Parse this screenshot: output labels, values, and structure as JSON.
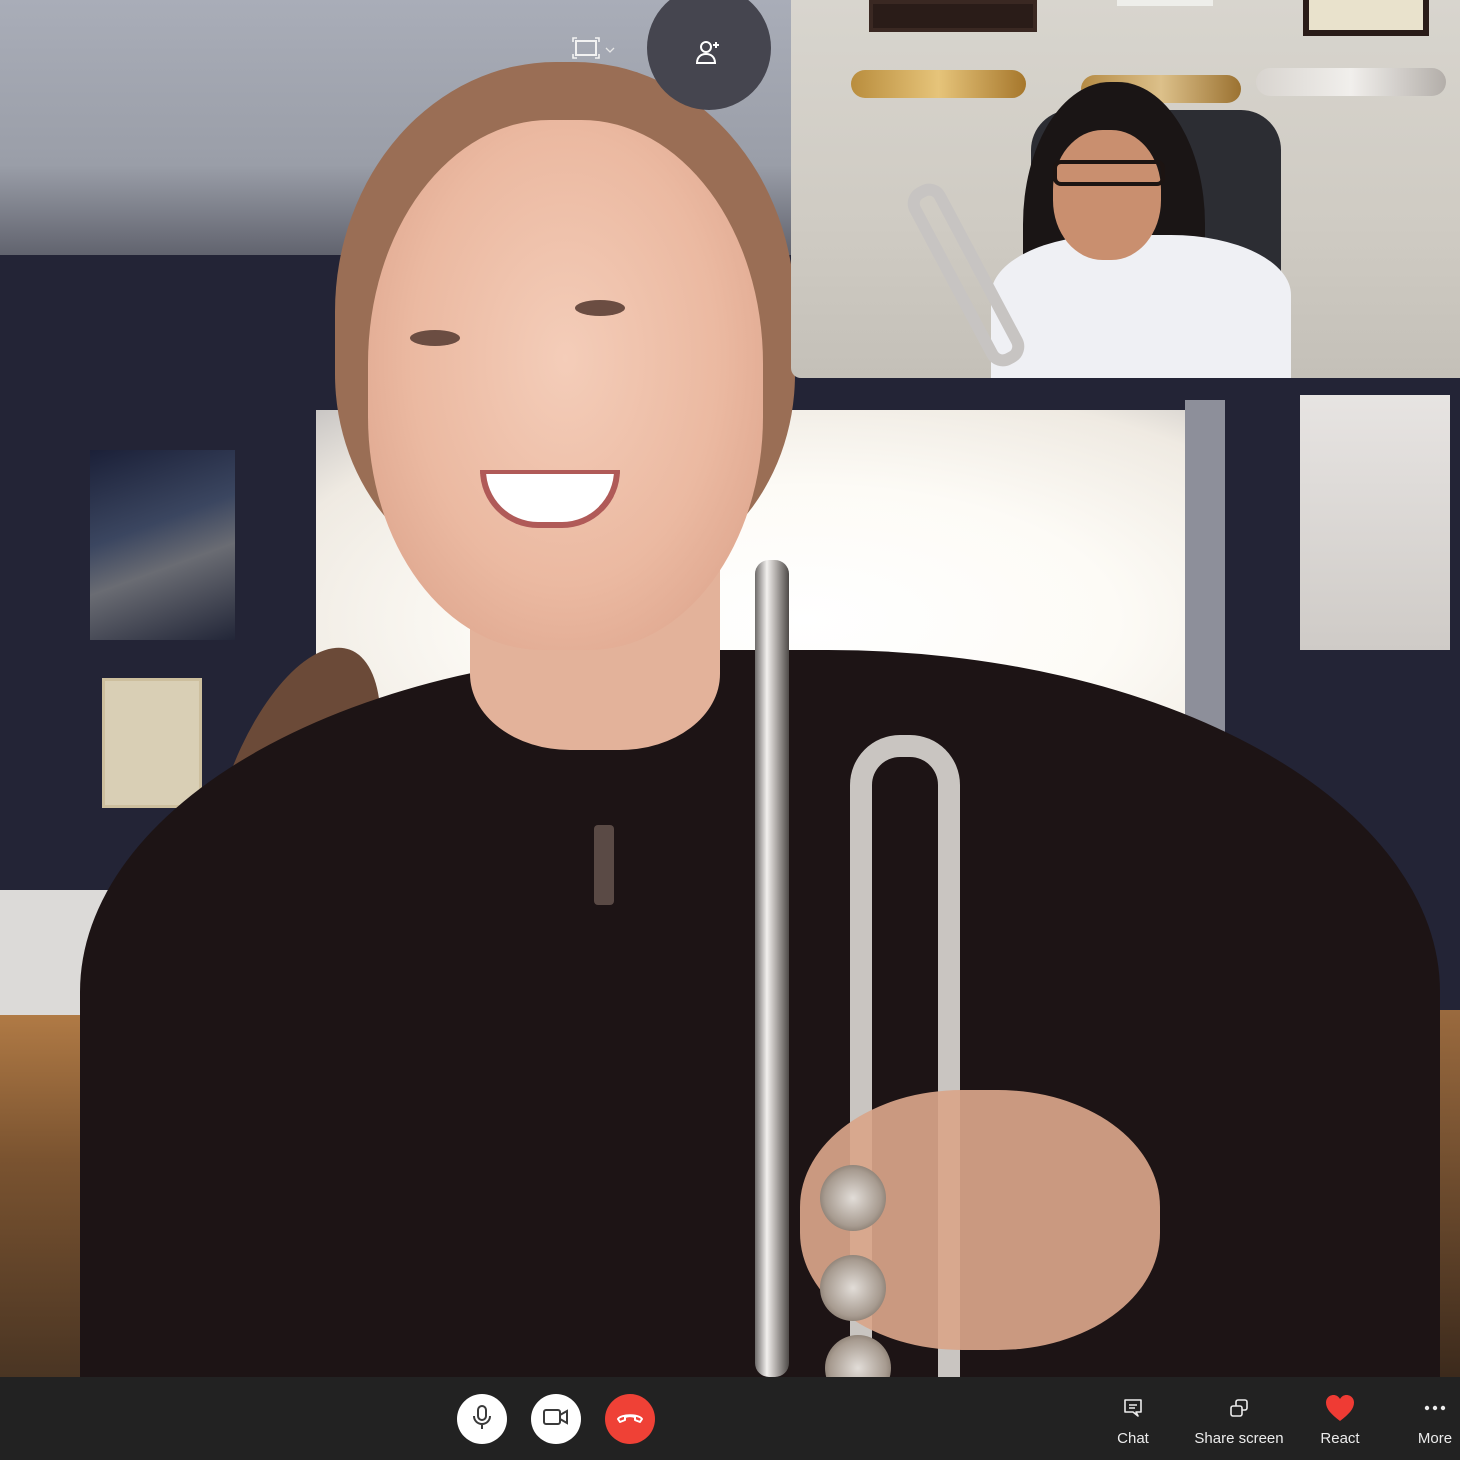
{
  "call": {
    "remote_participant": {
      "description": "Student smiling and holding a silver trumpet"
    },
    "self_view": {
      "description": "Teacher with glasses holding a silver trumpet, trumpets mounted on wall"
    }
  },
  "overlay": {
    "layout_button": {
      "icon": "frame-layout-icon",
      "dropdown_icon": "chevron-down-icon"
    },
    "add_participant_button": {
      "icon": "add-person-icon"
    }
  },
  "toolbar": {
    "mic": {
      "icon": "microphone-icon"
    },
    "camera": {
      "icon": "video-camera-icon"
    },
    "end_call": {
      "icon": "hang-up-icon",
      "color": "#ef4136"
    },
    "chat": {
      "label": "Chat",
      "icon": "chat-bubble-icon"
    },
    "share_screen": {
      "label": "Share screen",
      "icon": "share-screen-icon"
    },
    "react": {
      "label": "React",
      "icon": "heart-icon",
      "color": "#ef3b34"
    },
    "more": {
      "label": "More",
      "icon": "ellipsis-icon"
    }
  },
  "colors": {
    "toolbar_bg": "#222222",
    "add_participant_bg": "#45454f",
    "end_call_red": "#ef4136"
  }
}
